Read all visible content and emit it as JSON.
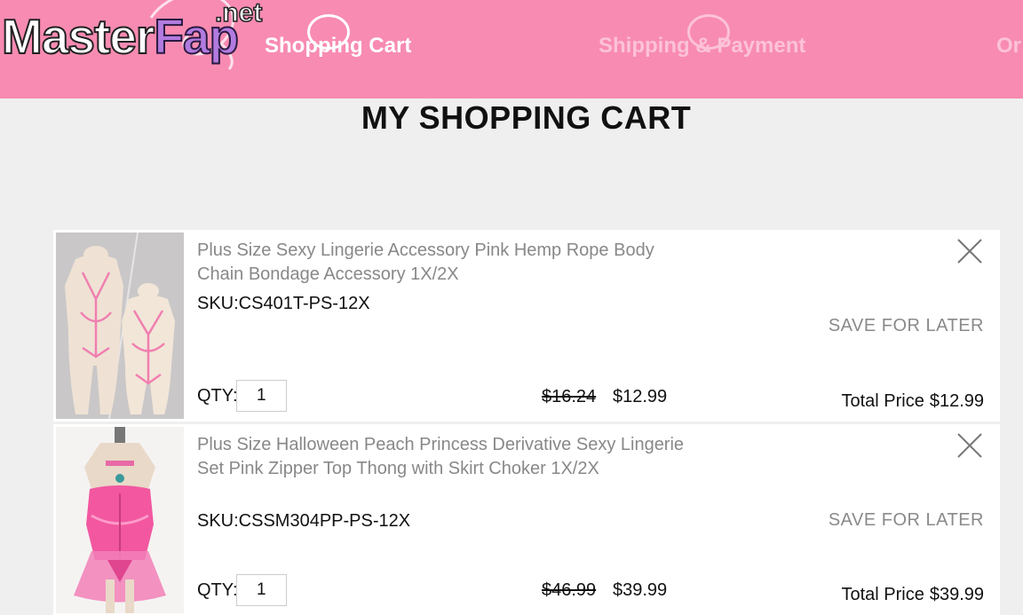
{
  "header": {
    "watermark": {
      "main_left": "Master",
      "main_right": "Fap",
      "suffix": ".net"
    },
    "steps": [
      {
        "label": "Shopping Cart",
        "active": true
      },
      {
        "label": "Shipping & Payment",
        "active": false
      },
      {
        "label": "Or",
        "active": false
      }
    ],
    "colors": {
      "header_bg": "#f88bb2",
      "inactive_step": "#fcc2d8"
    }
  },
  "page_title": "MY SHOPPING CART",
  "cart": {
    "items": [
      {
        "title": "Plus Size Sexy Lingerie Accessory Pink Hemp Rope Body Chain Bondage Accessory 1X/2X",
        "sku": "SKU:CS401T-PS-12X",
        "save_label": "SAVE FOR LATER",
        "qty_label": "QTY:",
        "qty_value": "1",
        "old_price": "$16.24",
        "new_price": "$12.99",
        "total_label": "Total Price",
        "total_value": "$12.99",
        "thumb_icon": "product-photo-rope-harness"
      },
      {
        "title": "Plus Size Halloween Peach Princess Derivative Sexy Lingerie Set Pink Zipper Top Thong with Skirt Choker 1X/2X",
        "sku": "SKU:CSSM304PP-PS-12X",
        "save_label": "SAVE FOR LATER",
        "qty_label": "QTY:",
        "qty_value": "1",
        "old_price": "$46.99",
        "new_price": "$39.99",
        "total_label": "Total Price",
        "total_value": "$39.99",
        "thumb_icon": "product-photo-pink-lingerie-set"
      }
    ]
  }
}
